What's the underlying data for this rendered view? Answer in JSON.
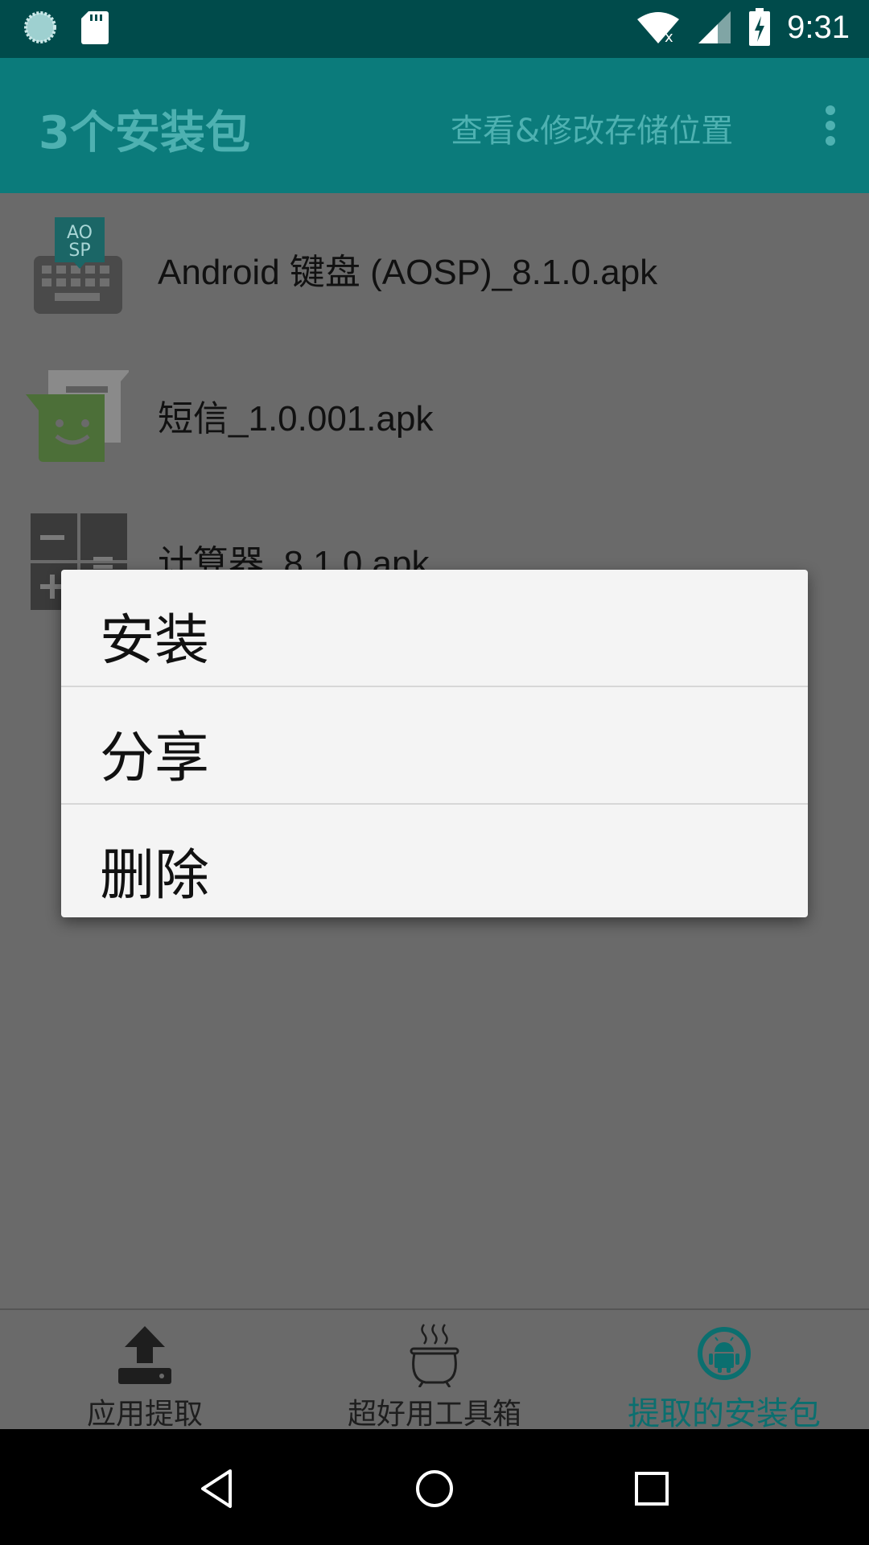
{
  "status_bar": {
    "time": "9:31",
    "icons": [
      "sync-icon",
      "sd-card-icon",
      "wifi-icon",
      "signal-icon",
      "battery-charging-icon"
    ]
  },
  "app_bar": {
    "title": "3个安装包",
    "action_label": "查看&修改存储位置",
    "more_icon": "more-vert-icon"
  },
  "apk_list": [
    {
      "name": "Android 键盘 (AOSP)_8.1.0.apk",
      "icon": "keyboard-aosp-icon"
    },
    {
      "name": "短信_1.0.001.apk",
      "icon": "messaging-icon"
    },
    {
      "name": "计算器_8.1.0.apk",
      "icon": "calculator-icon"
    }
  ],
  "dialog": {
    "items": [
      "安装",
      "分享",
      "删除"
    ]
  },
  "bottom_nav": {
    "items": [
      {
        "label": "应用提取",
        "icon": "upload-icon",
        "active": false
      },
      {
        "label": "超好用工具箱",
        "icon": "cauldron-icon",
        "active": false
      },
      {
        "label": "提取的安装包",
        "icon": "android-icon",
        "active": true
      }
    ]
  },
  "system_nav": [
    "back-icon",
    "home-icon",
    "recents-icon"
  ],
  "colors": {
    "status_bar": "#004b4b",
    "app_bar": "#0b7b7b",
    "accent": "#0b6f6f",
    "scrim_background": "#6a6a6a"
  }
}
